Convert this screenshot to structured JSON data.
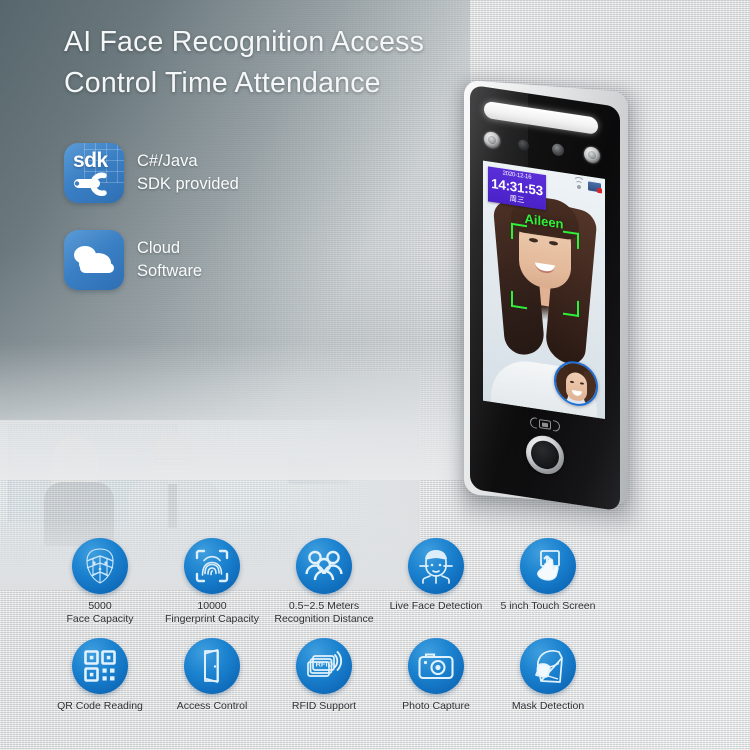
{
  "headline": {
    "line1": "AI Face Recognition Access",
    "line2": "Control Time Attendance"
  },
  "badges": [
    {
      "icon": "sdk-icon",
      "logo_text": "sdk",
      "line1": "C#/Java",
      "line2": "SDK provided"
    },
    {
      "icon": "cloud-icon",
      "logo_text": "",
      "line1": "Cloud",
      "line2": "Software"
    }
  ],
  "device": {
    "screen": {
      "date": "2020-12-16",
      "time": "14:31:53",
      "weekday": "周三",
      "recognized_name": "Aileen",
      "status_icons": [
        "wifi-icon",
        "network-icon"
      ]
    },
    "bottom_icons": [
      "rfid-reader-icon",
      "fingerprint-home-button"
    ],
    "top_icons": [
      "led-light-bar",
      "ir-sensor",
      "camera-lens",
      "camera-lens",
      "ir-sensor"
    ]
  },
  "features": {
    "row1": [
      {
        "icon": "face-mesh-icon",
        "line1": "5000",
        "line2": "Face Capacity"
      },
      {
        "icon": "fingerprint-icon",
        "line1": "10000",
        "line2": "Fingerprint Capacity"
      },
      {
        "icon": "people-group-icon",
        "line1": "0.5~2.5 Meters",
        "line2": "Recognition Distance"
      },
      {
        "icon": "live-face-icon",
        "line1": "",
        "line2": "Live Face Detection"
      },
      {
        "icon": "touch-screen-icon",
        "line1": "",
        "line2": "5 inch Touch Screen"
      }
    ],
    "row2": [
      {
        "icon": "qr-code-icon",
        "line1": "",
        "line2": "QR Code Reading"
      },
      {
        "icon": "door-icon",
        "line1": "",
        "line2": "Access Control"
      },
      {
        "icon": "rfid-card-icon",
        "line1": "",
        "line2": "RFID Support"
      },
      {
        "icon": "camera-icon",
        "line1": "",
        "line2": "Photo Capture"
      },
      {
        "icon": "face-mask-icon",
        "line1": "",
        "line2": "Mask Detection"
      }
    ]
  },
  "colors": {
    "accent_blue": "#1b82cf",
    "badge_blue": "#3a7fc4",
    "screen_clock_purple": "#4a22c8",
    "recognition_green": "#2ef23a",
    "headline_text": "#f4f6f7",
    "feature_label": "#2d3134",
    "background_wall": "#dcdcdc"
  }
}
